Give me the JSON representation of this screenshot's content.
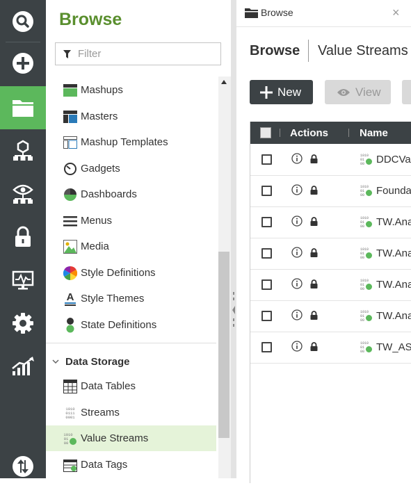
{
  "browse": {
    "title": "Browse",
    "filter_placeholder": "Filter"
  },
  "nav": {
    "items": [
      {
        "label": "Mashups",
        "icon": "mashup-icon"
      },
      {
        "label": "Masters",
        "icon": "master-icon"
      },
      {
        "label": "Mashup Templates",
        "icon": "mashup-template-icon"
      },
      {
        "label": "Gadgets",
        "icon": "gadget-icon"
      },
      {
        "label": "Dashboards",
        "icon": "dashboard-icon"
      },
      {
        "label": "Menus",
        "icon": "menu-icon"
      },
      {
        "label": "Media",
        "icon": "media-icon"
      },
      {
        "label": "Style Definitions",
        "icon": "style-definition-icon"
      },
      {
        "label": "Style Themes",
        "icon": "style-theme-icon"
      },
      {
        "label": "State Definitions",
        "icon": "state-definition-icon"
      }
    ],
    "section": {
      "label": "Data Storage",
      "icon": "chevron-down-icon"
    },
    "data_items": [
      {
        "label": "Data Tables",
        "icon": "data-table-icon"
      },
      {
        "label": "Streams",
        "icon": "stream-icon"
      },
      {
        "label": "Value Streams",
        "icon": "value-stream-icon",
        "selected": true
      },
      {
        "label": "Data Tags",
        "icon": "data-tag-icon"
      }
    ]
  },
  "rail": {
    "icons": [
      "search-icon",
      "add-icon",
      "folder-icon",
      "network-icon",
      "monitor-network-icon",
      "lock-icon",
      "monitoring-icon",
      "gear-icon",
      "analytics-icon",
      "import-export-icon"
    ]
  },
  "tab": {
    "label": "Browse",
    "icon": "folder-icon",
    "close": "×"
  },
  "breadcrumb": {
    "root": "Browse",
    "current": "Value Streams"
  },
  "toolbar": {
    "new_label": "New",
    "view_label": "View"
  },
  "grid": {
    "columns": [
      "Actions",
      "Name"
    ],
    "rows": [
      {
        "name": "DDCVa"
      },
      {
        "name": "Founda"
      },
      {
        "name": "TW.Ana"
      },
      {
        "name": "TW.Ana"
      },
      {
        "name": "TW.Ana"
      },
      {
        "name": "TW.Ana"
      },
      {
        "name": "TW_AS"
      }
    ]
  },
  "colors": {
    "rail_bg": "#3c4245",
    "accent_green": "#5cb85c",
    "title_green": "#5a8f2e",
    "selected_bg": "#e5f3d9"
  }
}
